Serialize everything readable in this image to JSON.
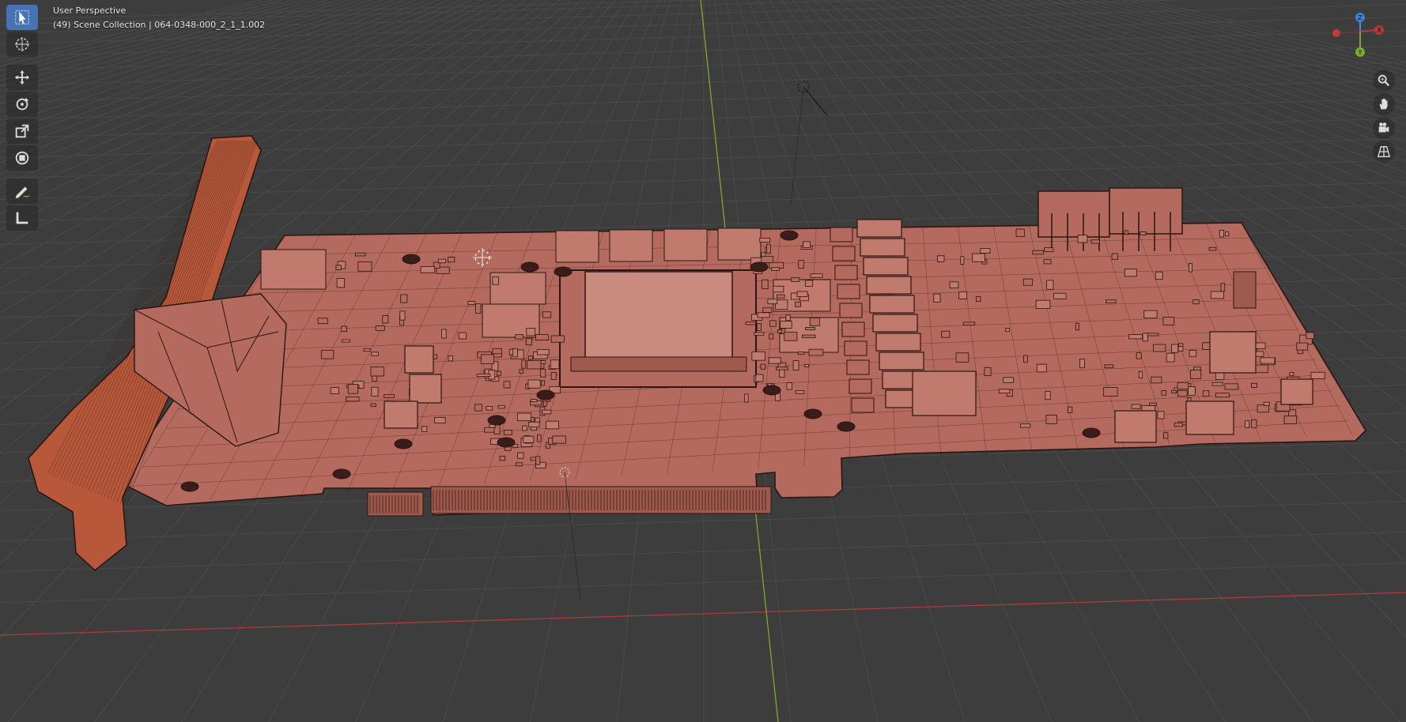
{
  "viewport": {
    "view_name": "User Perspective",
    "scene_info": "(49) Scene Collection | 064-0348-000_2_1_1.002",
    "colors": {
      "background": "#3d3d3d",
      "grid": "#4a4a4a",
      "x_axis": "#b03a3a",
      "y_axis": "#7ea832",
      "pcb": "#b46a5e",
      "component": "#c07a6e",
      "bracket": "#b8583a",
      "wire": "#2a1612",
      "active_tool": "#4772b3"
    }
  },
  "toolbar": {
    "tools": [
      {
        "name": "select-box-tool",
        "icon": "cursor-icon",
        "active": true
      },
      {
        "name": "cursor-tool",
        "icon": "target-icon",
        "active": false
      },
      {
        "name": "move-tool",
        "icon": "move-icon",
        "active": false
      },
      {
        "name": "rotate-tool",
        "icon": "rotate-icon",
        "active": false
      },
      {
        "name": "scale-tool",
        "icon": "scale-icon",
        "active": false
      },
      {
        "name": "transform-tool",
        "icon": "transform-icon",
        "active": false
      },
      {
        "name": "annotate-tool",
        "icon": "pencil-icon",
        "active": false
      },
      {
        "name": "measure-tool",
        "icon": "ruler-icon",
        "active": false
      }
    ]
  },
  "navigation": {
    "buttons": [
      {
        "name": "zoom-button",
        "icon": "magnifier-icon"
      },
      {
        "name": "pan-button",
        "icon": "hand-icon"
      },
      {
        "name": "camera-view-button",
        "icon": "camera-icon"
      },
      {
        "name": "perspective-toggle-button",
        "icon": "grid-icon"
      }
    ],
    "gizmo": {
      "z_label": "Z",
      "x_label": "X",
      "y_label": "Y"
    }
  }
}
